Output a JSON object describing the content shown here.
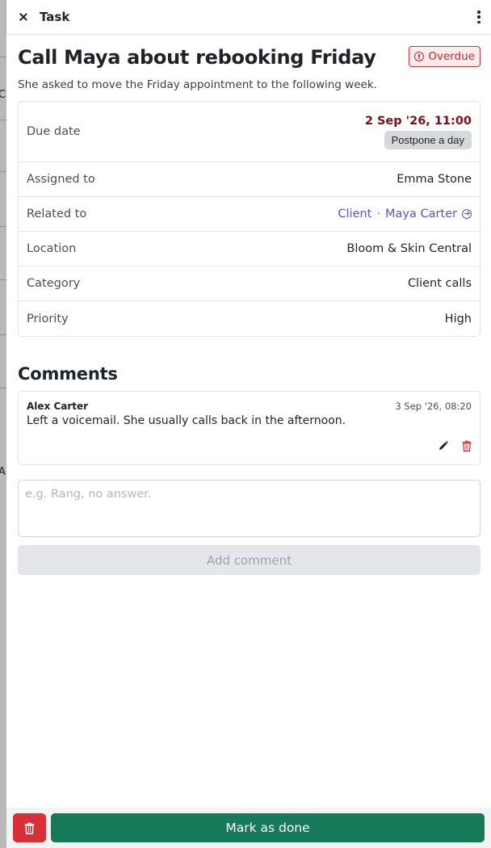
{
  "header": {
    "title": "Task"
  },
  "task": {
    "title": "Call Maya about rebooking Friday",
    "status_badge": "Overdue",
    "description": "She asked to move the Friday appointment to the following week."
  },
  "details": {
    "due": {
      "label": "Due date",
      "value": "2 Sep '26, 11:00",
      "postpone_label": "Postpone a day"
    },
    "assigned": {
      "label": "Assigned to",
      "value": "Emma Stone"
    },
    "related": {
      "label": "Related to",
      "type": "Client",
      "separator": "·",
      "name": "Maya Carter"
    },
    "location": {
      "label": "Location",
      "value": "Bloom & Skin Central"
    },
    "category": {
      "label": "Category",
      "value": "Client calls"
    },
    "priority": {
      "label": "Priority",
      "value": "High"
    }
  },
  "comments": {
    "heading": "Comments",
    "items": [
      {
        "author": "Alex Carter",
        "time": "3 Sep '26, 08:20",
        "text": "Left a voicemail. She usually calls back in the afternoon."
      }
    ],
    "input_placeholder": "e.g. Rang, no answer.",
    "add_label": "Add comment"
  },
  "footer": {
    "done_label": "Mark as done"
  },
  "background": {
    "fragments": [
      "Co",
      "Al"
    ]
  },
  "colors": {
    "overdue": "#c8222c",
    "due_date": "#7a0f16",
    "link": "#5a56c7",
    "primary": "#167a5a",
    "danger": "#d83036"
  },
  "icons": {
    "close": "close-icon",
    "menu": "kebab-menu-icon",
    "overdue": "alert-circle-icon",
    "related": "arrow-circle-icon",
    "edit": "pencil-icon",
    "delete": "trash-icon"
  }
}
